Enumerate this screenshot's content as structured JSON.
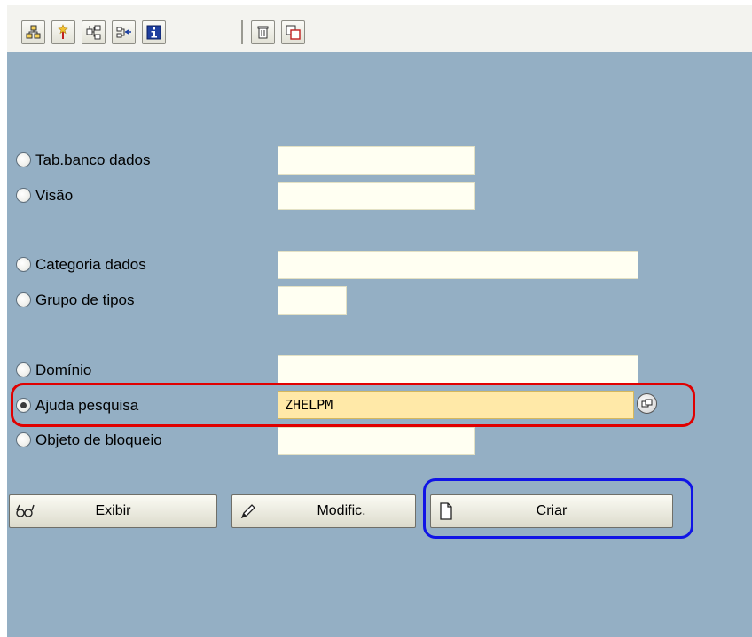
{
  "toolbar": {
    "buttons": [
      {
        "icon": "hierarchy-icon"
      },
      {
        "icon": "activate-wand-icon"
      },
      {
        "icon": "where-used-icon"
      },
      {
        "icon": "other-object-icon"
      },
      {
        "icon": "info-icon"
      },
      {
        "icon": "delete-trash-icon"
      },
      {
        "icon": "copy-icon"
      }
    ]
  },
  "form": {
    "options": [
      {
        "label": "Tab.banco dados",
        "value": "",
        "selected": false
      },
      {
        "label": "Visão",
        "value": "",
        "selected": false
      },
      {
        "label": "Categoria dados",
        "value": "",
        "selected": false
      },
      {
        "label": "Grupo de tipos",
        "value": "",
        "selected": false
      },
      {
        "label": "Domínio",
        "value": "",
        "selected": false
      },
      {
        "label": "Ajuda pesquisa",
        "value": "ZHELPM",
        "selected": true
      },
      {
        "label": "Objeto de bloqueio",
        "value": "",
        "selected": false
      }
    ]
  },
  "actions": {
    "display_label": "Exibir",
    "change_label": "Modific.",
    "create_label": "Criar"
  },
  "colors": {
    "background": "#94afc4",
    "field": "#fffff2",
    "active_field": "#ffe9a8",
    "highlight_red": "#e00000",
    "highlight_blue": "#1014e6"
  }
}
